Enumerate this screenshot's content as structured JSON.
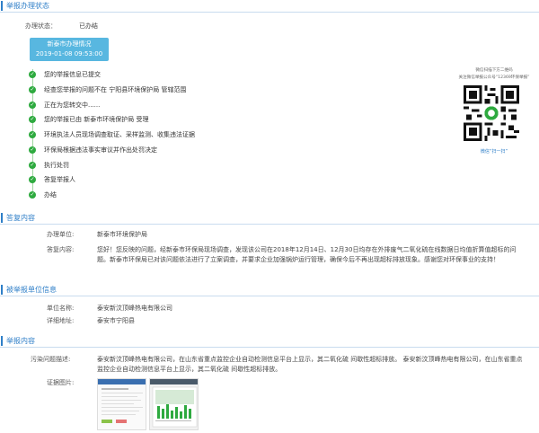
{
  "status_section": {
    "title": "举报办理状态",
    "status_label": "办理状态：",
    "status_value": "已办结",
    "unit_name": "新泰市办理情况",
    "unit_time": "2019-01-08 09:53:00",
    "steps": [
      "您的举报信息已提交",
      "经查您举报的问题不在 宁阳县环境保护局 管辖范围",
      "正在为您转交中......",
      "您的举报已由 新泰市环境保护局 受理",
      "环境执法人员现场调查取证、采样监测、收集违法证据",
      "环保局根据违法事实审议并作出处罚决定",
      "执行处罚",
      "答复举报人",
      "办结"
    ],
    "qr_caption_line1": "微信扫描下方二维码",
    "qr_caption_line2": "关注微信举报公众号“12369环保举报”",
    "qr_scan_label": "微信“扫一扫”"
  },
  "reply_section": {
    "title": "答复内容",
    "unit_label": "办理单位:",
    "unit_value": "新泰市环境保护局",
    "content_label": "答复内容:",
    "content_value": "您好！您反映的问题，经新泰市环保局现场调查，发现该公司在2018年12月14日、12月30日均存在外排废气二氧化硫在线数据日均值折算值超标的问题。新泰市环保局已对该问题依法进行了立案调查，并要求企业加强锅炉运行管理，确保今后不再出现超标排放现象。感谢您对环保事业的支持！"
  },
  "target_section": {
    "title": "被举报单位信息",
    "name_label": "单位名称:",
    "name_value": "泰安新汶顶峰热电有限公司",
    "addr_label": "详细地址:",
    "addr_value": "泰安市宁阳县"
  },
  "report_section": {
    "title": "举报内容",
    "desc_label": "污染问题描述:",
    "desc_value": "泰安新汶顶峰热电有限公司，在山东省重点监控企业自动检测信息平台上显示，其二氧化硫 间歇性超标排放。 泰安新汶顶峰热电有限公司，在山东省重点监控企业自动检测信息平台上显示，其二氧化硫 间歇性超标排放。",
    "photo_label": "证据图片:"
  },
  "icons": {
    "step_icon": "check-circle-icon",
    "qr_icon": "qr-code-icon"
  },
  "colors": {
    "accent": "#2f7fc8",
    "step_green": "#2eaa3f",
    "time_box": "#58b7e0"
  }
}
